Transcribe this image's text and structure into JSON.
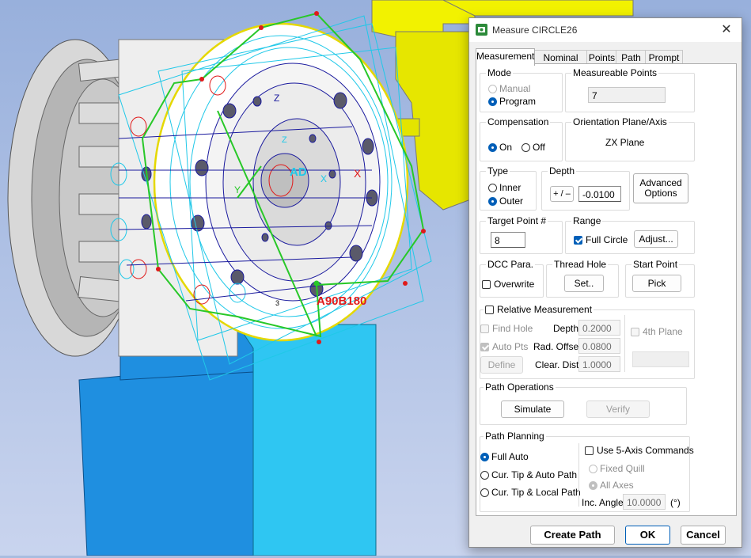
{
  "dialog": {
    "title": "Measure CIRCLE26",
    "close_glyph": "✕",
    "tabs": [
      "Measurement",
      "Nominal",
      "Points",
      "Path",
      "Prompt"
    ],
    "active_tab": "Measurement"
  },
  "viewport": {
    "label_ad": "AD",
    "label_z": "Z",
    "label_y": "Y",
    "label_x": "X",
    "label_small_x": "X",
    "label_small_z": "Z",
    "label_angle": "A90B180",
    "label_point": "3"
  },
  "mode": {
    "label": "Mode",
    "manual": "Manual",
    "program": "Program",
    "selected": "Program"
  },
  "measurable_points": {
    "label": "Measureable Points",
    "value": "7"
  },
  "compensation": {
    "label": "Compensation",
    "on": "On",
    "off": "Off",
    "selected": "On"
  },
  "orientation": {
    "label": "Orientation Plane/Axis",
    "value": "ZX Plane"
  },
  "type": {
    "label": "Type",
    "inner": "Inner",
    "outer": "Outer",
    "selected": "Outer"
  },
  "depth": {
    "label": "Depth",
    "sign_button": "+ / –",
    "value": "-0.0100"
  },
  "advanced_options": {
    "label_line1": "Advanced",
    "label_line2": "Options"
  },
  "target_point": {
    "label": "Target Point #",
    "value": "8"
  },
  "range": {
    "label": "Range",
    "full_circle": "Full Circle",
    "full_circle_checked": true,
    "adjust": "Adjust..."
  },
  "dcc_para": {
    "label": "DCC Para.",
    "overwrite": "Overwrite",
    "overwrite_checked": false
  },
  "thread_hole": {
    "label": "Thread Hole",
    "set": "Set.."
  },
  "start_point": {
    "label": "Start Point",
    "pick": "Pick"
  },
  "relative_measurement": {
    "label": "Relative Measurement",
    "checked": false,
    "find_hole": "Find Hole",
    "auto_pts": "Auto Pts",
    "define": "Define",
    "depth_label": "Depth",
    "depth_value": "0.2000",
    "rad_offset_label": "Rad. Offset",
    "rad_offset_value": "0.0800",
    "clear_dist_label": "Clear. Dist.",
    "clear_dist_value": "1.0000",
    "fourth_plane": "4th Plane"
  },
  "path_operations": {
    "label": "Path Operations",
    "simulate": "Simulate",
    "verify": "Verify"
  },
  "path_planning": {
    "label": "Path Planning",
    "full_auto": "Full Auto",
    "cur_tip_auto": "Cur. Tip & Auto Path",
    "cur_tip_local": "Cur. Tip & Local Path",
    "selected": "Full Auto",
    "use_5axis": "Use 5-Axis Commands",
    "fixed_quill": "Fixed Quill",
    "all_axes": "All Axes",
    "inc_angle_label": "Inc. Angle",
    "inc_angle_value": "10.0000",
    "inc_angle_unit": "(°)"
  },
  "footer": {
    "create_path": "Create Path",
    "ok": "OK",
    "cancel": "Cancel"
  },
  "colors": {
    "yellow_part": "#f2f200",
    "blue_base": "#1f8fe0",
    "cyan_base": "#2fc6f2",
    "green_path": "#28c828",
    "navy_lines": "#1a1a9e",
    "red_label": "#e01a1a",
    "accent": "#005fb8"
  }
}
